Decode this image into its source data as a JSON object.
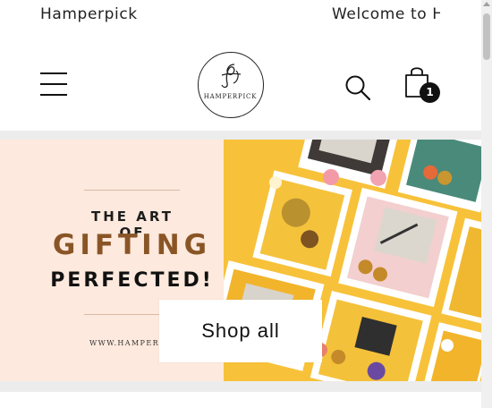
{
  "announcement": {
    "left_text": "Hamperpick",
    "right_text": "Welcome to H"
  },
  "header": {
    "logo_text": "HAMPERPICK",
    "cart_count": "1",
    "icons": [
      "menu-icon",
      "search-icon",
      "bag-icon"
    ]
  },
  "hero": {
    "line1": "THE ART OF",
    "line2": "GIFTING",
    "line3": "PERFECTED!",
    "website": "WWW.HAMPERPICK",
    "button_label": "Shop all"
  },
  "colors": {
    "banner_bg": "#fde9dd",
    "accent_brown": "#8a5526",
    "collage_yellow": "#f6b31e",
    "band_gray": "#ececec"
  }
}
